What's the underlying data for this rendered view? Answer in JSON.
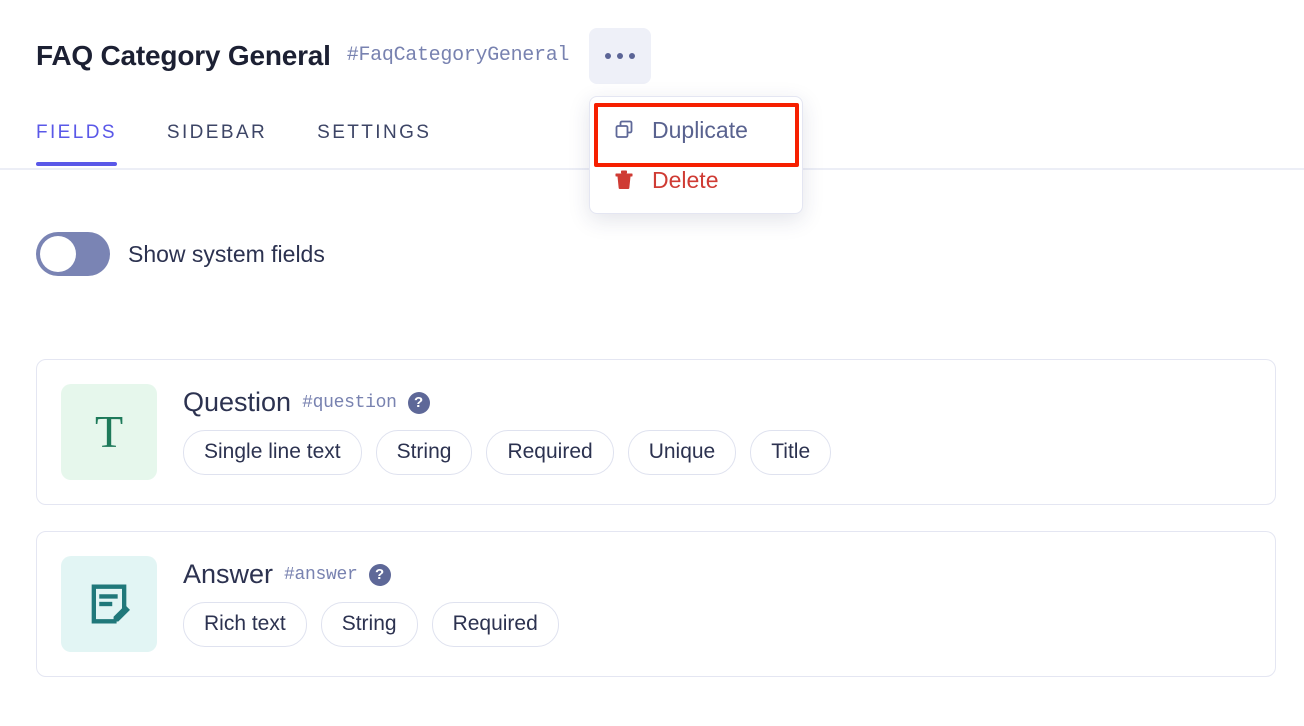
{
  "header": {
    "title": "FAQ Category General",
    "slug": "#FaqCategoryGeneral",
    "more_button_name": "more-options"
  },
  "tabs": [
    {
      "label": "FIELDS",
      "active": true
    },
    {
      "label": "SIDEBAR",
      "active": false
    },
    {
      "label": "SETTINGS",
      "active": false
    }
  ],
  "toggle": {
    "label": "Show system fields",
    "state": "off"
  },
  "dropdown": {
    "visible": true,
    "items": [
      {
        "label": "Duplicate",
        "icon": "copy-icon",
        "color": "#59628f",
        "highlighted": true
      },
      {
        "label": "Delete",
        "icon": "trash-icon",
        "color": "#cf3b34",
        "highlighted": false
      }
    ],
    "highlight_color": "#f61f00"
  },
  "fields": [
    {
      "name": "Question",
      "slug": "#question",
      "icon": "text-field-icon",
      "icon_glyph": "T",
      "icon_bg": "#e6f7ec",
      "icon_color": "#1e7a5a",
      "help": "?",
      "tags": [
        "Single line text",
        "String",
        "Required",
        "Unique",
        "Title"
      ]
    },
    {
      "name": "Answer",
      "slug": "#answer",
      "icon": "rich-text-field-icon",
      "icon_glyph": "",
      "icon_bg": "#e2f5f4",
      "icon_color": "#20787a",
      "help": "?",
      "tags": [
        "Rich text",
        "String",
        "Required"
      ]
    }
  ],
  "colors": {
    "accent": "#5a58e8",
    "text_primary": "#2c3250",
    "text_muted": "#7882b0",
    "danger": "#cf3b34",
    "border": "#e4e6f2"
  }
}
